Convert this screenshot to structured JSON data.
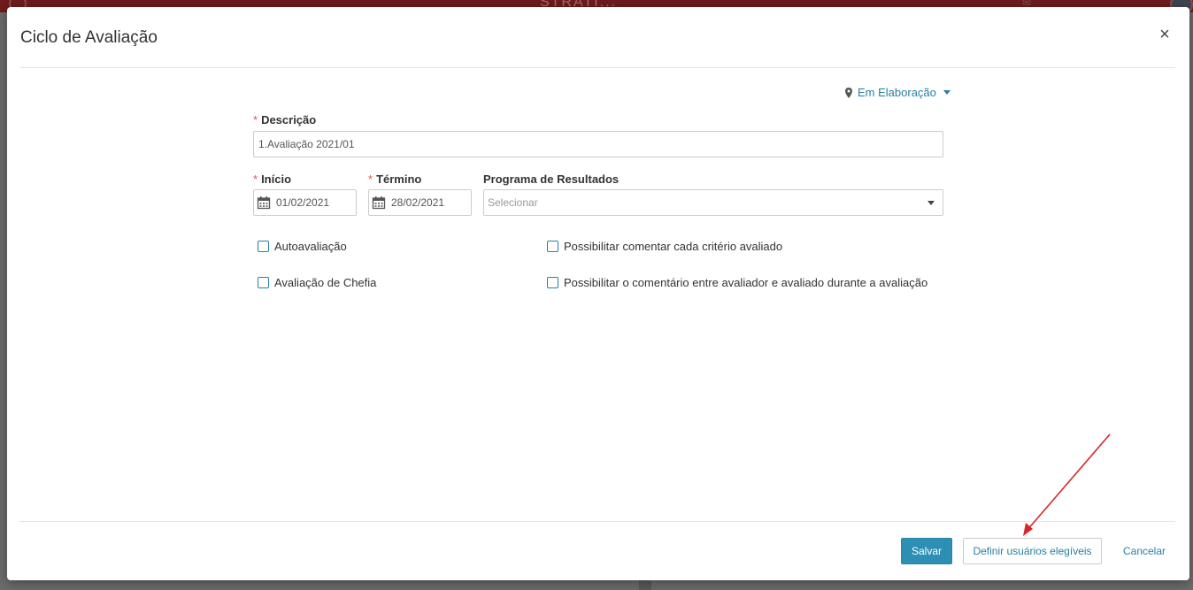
{
  "background_app": {
    "brand": "STRATI...",
    "topbar_color": "#6e1b1b"
  },
  "modal": {
    "title": "Ciclo de Avaliação",
    "close_symbol": "×"
  },
  "status": {
    "icon": "map-pin-icon",
    "label": "Em Elaboração"
  },
  "form": {
    "required_mark": "*",
    "descricao": {
      "label": "Descrição",
      "value": "1.Avaliação 2021/01"
    },
    "inicio": {
      "label": "Início",
      "value": "01/02/2021",
      "icon": "calendar-icon"
    },
    "termino": {
      "label": "Término",
      "value": "28/02/2021",
      "icon": "calendar-icon"
    },
    "programa": {
      "label": "Programa de Resultados",
      "placeholder": "Selecionar"
    },
    "checkboxes": [
      {
        "label": "Autoavaliação",
        "checked": false
      },
      {
        "label": "Possibilitar comentar cada critério avaliado",
        "checked": false
      },
      {
        "label": "Avaliação de Chefia",
        "checked": false
      },
      {
        "label": "Possibilitar o comentário entre avaliador e avaliado durante a avaliação",
        "checked": false
      }
    ]
  },
  "footer": {
    "save_label": "Salvar",
    "define_users_label": "Definir usuários elegíveis",
    "cancel_label": "Cancelar"
  },
  "colors": {
    "accent": "#2a7fa6",
    "primary_button": "#2d8fb3",
    "required": "#d9534f",
    "annotation_arrow": "#d9252a"
  }
}
